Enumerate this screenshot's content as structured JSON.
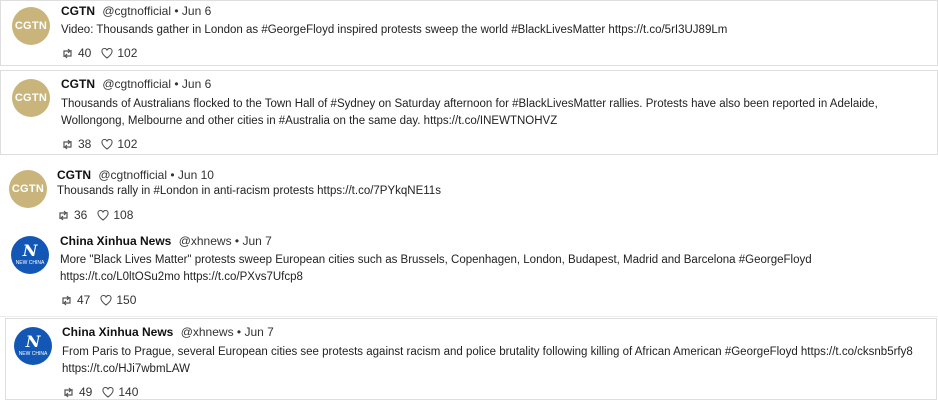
{
  "tweets": [
    {
      "avatar": "CGTN",
      "name": "CGTN",
      "handle": "@cgtnofficial",
      "separator": "•",
      "date": "Jun 6",
      "text": "Video: Thousands gather in London as #GeorgeFloyd inspired protests sweep the world #BlackLivesMatter https://t.co/5rI3UJ89Lm",
      "retweets": "40",
      "likes": "102"
    },
    {
      "avatar": "CGTN",
      "name": "CGTN",
      "handle": "@cgtnofficial",
      "separator": "•",
      "date": "Jun 6",
      "text": "Thousands of Australians flocked to the Town Hall of #Sydney on Saturday afternoon for #BlackLivesMatter rallies. Protests have also been reported in Adelaide, Wollongong, Melbourne and other cities in #Australia on the same day. https://t.co/INEWTNOHVZ",
      "retweets": "38",
      "likes": "102"
    },
    {
      "avatar": "CGTN",
      "name": "CGTN",
      "handle": "@cgtnofficial",
      "separator": "•",
      "date": "Jun 10",
      "text": "Thousands rally in #London in anti-racism protests https://t.co/7PYkqNE11s",
      "retweets": "36",
      "likes": "108"
    },
    {
      "avatar": "NEW CHINA",
      "name": "China Xinhua News",
      "handle": "@xhnews",
      "separator": "•",
      "date": "Jun 7",
      "text": "More \"Black Lives Matter\" protests sweep European cities such as Brussels, Copenhagen, London, Budapest, Madrid and Barcelona #GeorgeFloyd https://t.co/L0ltOSu2mo https://t.co/PXvs7Ufcp8",
      "retweets": "47",
      "likes": "150"
    },
    {
      "avatar": "NEW CHINA",
      "name": "China Xinhua News",
      "handle": "@xhnews",
      "separator": "•",
      "date": "Jun 7",
      "text": "From Paris to Prague, several European cities see protests against racism and police brutality following killing of African American #GeorgeFloyd https://t.co/cksnb5rfy8 https://t.co/HJi7wbmLAW",
      "retweets": "49",
      "likes": "140"
    }
  ]
}
